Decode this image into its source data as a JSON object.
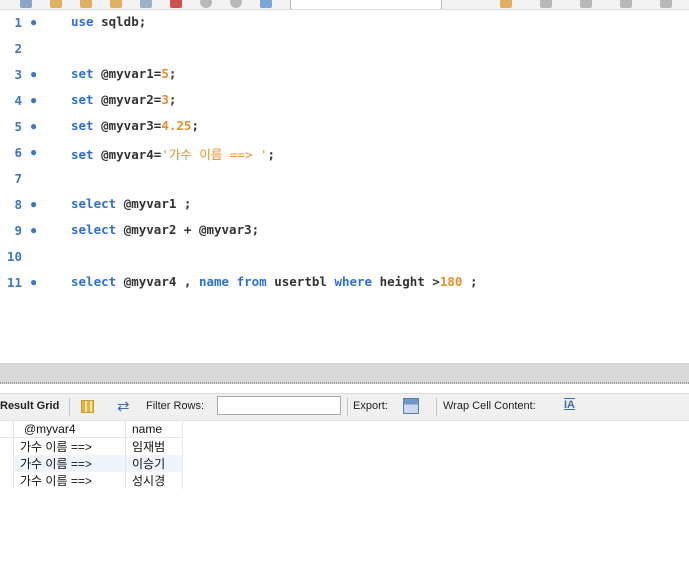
{
  "editor": {
    "lines": [
      {
        "n": "1",
        "bp": true
      },
      {
        "n": "2",
        "bp": false
      },
      {
        "n": "3",
        "bp": true
      },
      {
        "n": "4",
        "bp": true
      },
      {
        "n": "5",
        "bp": true
      },
      {
        "n": "6",
        "bp": true
      },
      {
        "n": "7",
        "bp": false
      },
      {
        "n": "8",
        "bp": true
      },
      {
        "n": "9",
        "bp": true
      },
      {
        "n": "10",
        "bp": false
      },
      {
        "n": "11",
        "bp": true
      }
    ],
    "code": {
      "use": "use",
      "db": "sqldb;",
      "set": "set",
      "v1": "@myvar1=",
      "v1val": "5",
      "v1end": ";",
      "v2": "@myvar2=",
      "v2val": "3",
      "v2end": ";",
      "v3": "@myvar3=",
      "v3val": "4.25",
      "v3end": ";",
      "v4": "@myvar4=",
      "v4val": "'가수 이름 ==> '",
      "v4end": ";",
      "select": "select",
      "l8rest": "@myvar1 ;",
      "l9rest": "@myvar2 + @myvar3;",
      "l11a": "@myvar4 , ",
      "name_kw": "name",
      "from_kw": "from",
      "tbl": "usertbl",
      "where_kw": "where",
      "cond": "height >",
      "num180": "180",
      "l11end": " ;"
    }
  },
  "result_toolbar": {
    "result_grid": "Result Grid",
    "filter_rows": "Filter Rows:",
    "filter_value": "",
    "export": "Export:",
    "wrap_cell": "Wrap Cell Content:"
  },
  "grid": {
    "columns": [
      "@myvar4",
      "name"
    ],
    "rows": [
      [
        "가수 이름 ==>",
        "임재범"
      ],
      [
        "가수 이름 ==>",
        "이승기"
      ],
      [
        "가수 이름 ==>",
        "성시경"
      ]
    ]
  },
  "colors": {
    "keyword": "#2e6fd3",
    "number": "#e6912a",
    "line_number": "#3b77c8"
  }
}
